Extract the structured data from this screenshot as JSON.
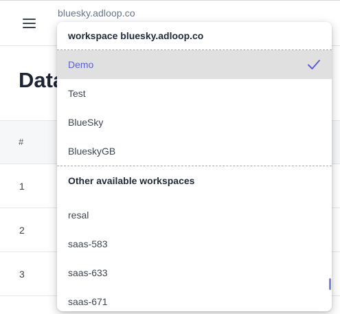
{
  "header": {
    "workspace_name": "bluesky.adloop.co",
    "menu_icon": "hamburger-menu-icon"
  },
  "main": {
    "title": "Data"
  },
  "table": {
    "header": "#",
    "rows": [
      "1",
      "2",
      "3"
    ]
  },
  "dropdown": {
    "header": "workspace bluesky.adloop.co",
    "current_workspaces": [
      {
        "label": "Demo",
        "selected": true
      },
      {
        "label": "Test",
        "selected": false
      },
      {
        "label": "BlueSky",
        "selected": false
      },
      {
        "label": "BlueskyGB",
        "selected": false
      }
    ],
    "check_icon": "checkmark-icon",
    "other_section_label": "Other available workspaces",
    "other_workspaces": [
      "resal",
      "saas-583",
      "saas-633",
      "saas-671"
    ]
  },
  "colors": {
    "accent": "#5a5fcf",
    "selected_bg": "#e0e0e0",
    "scroll_thumb": "#7b80f0"
  }
}
